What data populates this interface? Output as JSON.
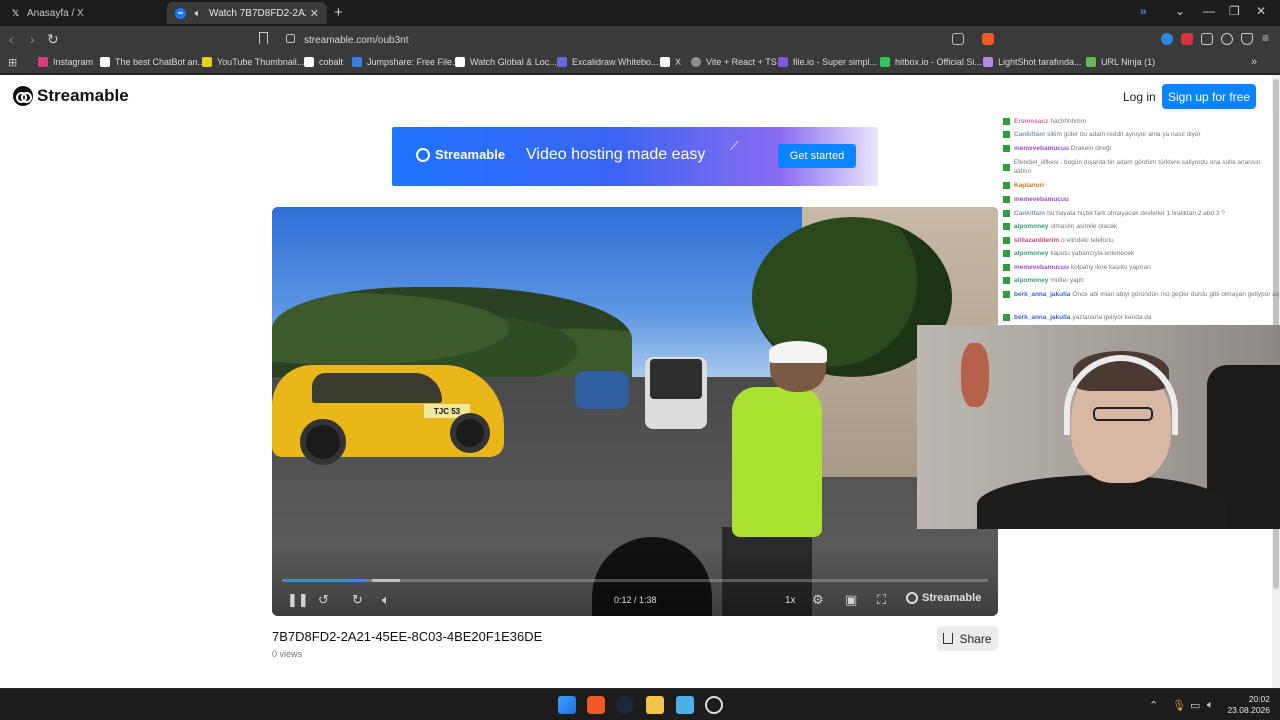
{
  "browser": {
    "tabs": [
      {
        "title": "Anasayfa / X",
        "icon": "x-logo-icon"
      },
      {
        "title": "Watch 7B7D8FD2-2A21-45EE",
        "icon": "streamable-icon"
      }
    ],
    "url": "streamable.com/oub3nt",
    "bookmarks": [
      {
        "label": "Instagram",
        "color": "#d93c78"
      },
      {
        "label": "The best ChatBot an...",
        "color": "#ffffff"
      },
      {
        "label": "YouTube Thumbnail...",
        "color": "#e5d21f"
      },
      {
        "label": "cobalt",
        "color": "#ffffff"
      },
      {
        "label": "Jumpshare: Free File...",
        "color": "#3b7ddd"
      },
      {
        "label": "Watch Global & Loc...",
        "color": "#ffffff"
      },
      {
        "label": "Excalidraw Whitebo...",
        "color": "#6965db"
      },
      {
        "label": "X",
        "color": "#ffffff"
      },
      {
        "label": "Vite + React + TS",
        "color": "#8f8f8f"
      },
      {
        "label": "file.io - Super simpl...",
        "color": "#7a5be0"
      },
      {
        "label": "hitbox.io - Official Si...",
        "color": "#37c25a"
      },
      {
        "label": "LightShot tarafında...",
        "color": "#b48ae6"
      },
      {
        "label": "URL Ninja (1)",
        "color": "#6bb85c"
      }
    ]
  },
  "site": {
    "brand": "Streamable",
    "login": "Log in",
    "signup": "Sign up for free",
    "accent": "#0a84ff"
  },
  "banner": {
    "brand": "Streamable",
    "tagline": "Video hosting made easy",
    "cta": "Get started"
  },
  "player": {
    "time": "0:12 / 1:38",
    "speed": "1x",
    "brand": "Streamable",
    "plate": "TJC 53",
    "progress_fraction": 0.12
  },
  "video": {
    "title": "7B7D8FD2-2A21-45EE-8C03-4BE20F1E36DE",
    "views": "0 views",
    "share": "Share"
  },
  "chat": [
    {
      "user": "Ersmnsacz",
      "msg": "hachhhhmm",
      "color": "#d86a9a"
    },
    {
      "user": "Cankiltam",
      "msg": "sikim güler bu adam reddit aynıyor anla ya nasıl diyor",
      "color": "#7a9ac8"
    },
    {
      "user": "memevebamucuu",
      "msg": "Drakein direği",
      "color": "#9a4fc8"
    },
    {
      "user": "",
      "msg": "Efendiel_ilifkesi : bugün dışarda bir adam gördüm türklere saliyordu ona sulla anansın aldılın",
      "color": "#7a7a7a"
    },
    {
      "user": "Kaplanuri",
      "msg": "",
      "color": "#c8782a"
    },
    {
      "user": "memevebamucuu",
      "msg": "",
      "color": "#9a4fc8"
    },
    {
      "user": "Cankiltam",
      "msg": "bu hayata hiçbir fark olmayacak devletler 1 liraliktan 2 abd 3 ?",
      "color": "#7a9ac8"
    },
    {
      "user": "alpomoney",
      "msg": "olmaslın asimile olacak",
      "color": "#3a9a7a"
    },
    {
      "user": "sililazardilerim",
      "msg": "o elindeki telefonu",
      "color": "#c84a7a"
    },
    {
      "user": "alpomoney",
      "msg": "kaputu yabancıyla erilenecek",
      "color": "#3a9a7a"
    },
    {
      "user": "memevebamucuu",
      "msg": "kolpany ikne kaşıks yapıran",
      "color": "#9a4fc8"
    },
    {
      "user": "alpomoney",
      "msg": "mülteı yaptı",
      "color": "#3a9a7a"
    },
    {
      "user": "berk_anna_jakulla",
      "msg": "Önce abi mlan abiyi göründün mü geçler durdu gibi olmayan gellypor aq",
      "color": "#3a6ac8"
    },
    {
      "user": "berk_anna_jakulla",
      "msg": "yazlanana geliyor kenda da",
      "color": "#3a6ac8"
    }
  ],
  "taskbar": {
    "time": "20:02",
    "date": "23.08.2026"
  }
}
